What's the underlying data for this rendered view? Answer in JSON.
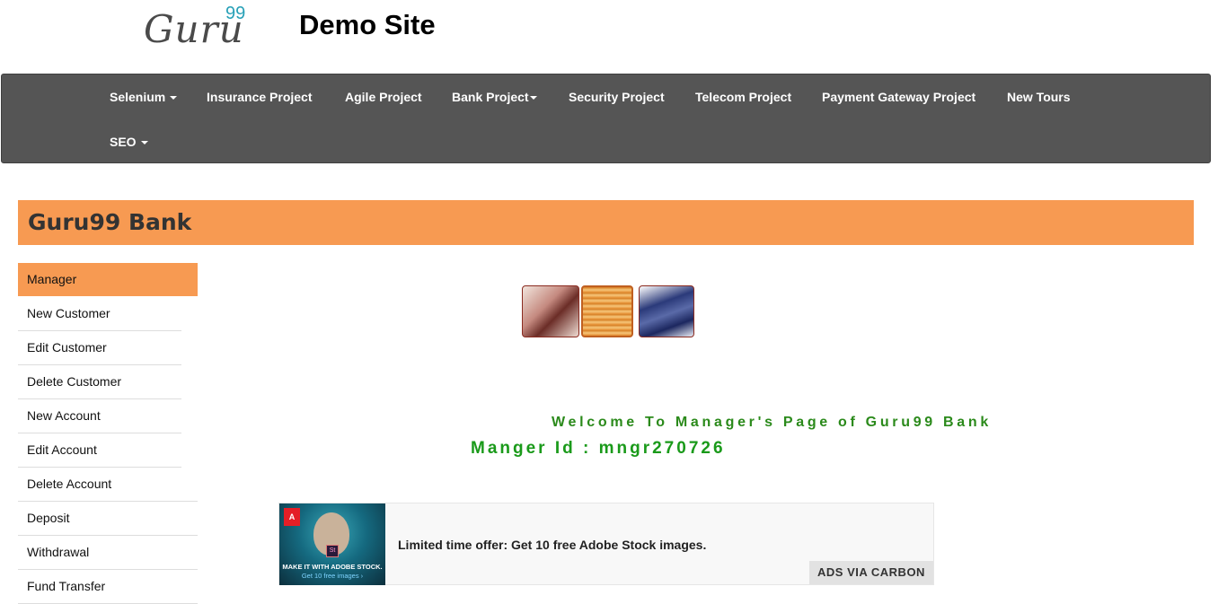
{
  "header": {
    "logo_text": "Guru",
    "logo_sup": "99",
    "site_title": "Demo Site"
  },
  "navbar": {
    "items": [
      {
        "label": "Selenium",
        "dropdown": true
      },
      {
        "label": "Insurance Project",
        "dropdown": false
      },
      {
        "label": "Agile Project",
        "dropdown": false
      },
      {
        "label": "Bank Project",
        "dropdown": true
      },
      {
        "label": "Security Project",
        "dropdown": false
      },
      {
        "label": "Telecom Project",
        "dropdown": false
      },
      {
        "label": "Payment Gateway Project",
        "dropdown": false
      },
      {
        "label": "New Tours",
        "dropdown": false
      },
      {
        "label": "SEO",
        "dropdown": true
      }
    ]
  },
  "banner": {
    "title": "Guru99 Bank"
  },
  "sidebar": {
    "items": [
      {
        "label": "Manager",
        "active": true
      },
      {
        "label": "New Customer"
      },
      {
        "label": "Edit Customer"
      },
      {
        "label": "Delete Customer"
      },
      {
        "label": "New Account"
      },
      {
        "label": "Edit Account"
      },
      {
        "label": "Delete Account"
      },
      {
        "label": "Deposit"
      },
      {
        "label": "Withdrawal"
      },
      {
        "label": "Fund Transfer"
      }
    ]
  },
  "main": {
    "welcome": "Welcome To Manager's Page of Guru99 Bank",
    "manager_id": "Manger Id : mngr270726"
  },
  "ad": {
    "adobe_mark": "A",
    "st_mark": "St",
    "caption_line1": "MAKE IT WITH ADOBE STOCK.",
    "caption_line2": "Get 10 free images ›",
    "text": "Limited time offer: Get 10 free Adobe Stock images.",
    "via": "ADS VIA CARBON"
  },
  "colors": {
    "navbar_bg": "#555555",
    "accent_orange": "#f79a52",
    "welcome_green": "#2b8a1b",
    "logo_teal": "#27a0b7"
  }
}
